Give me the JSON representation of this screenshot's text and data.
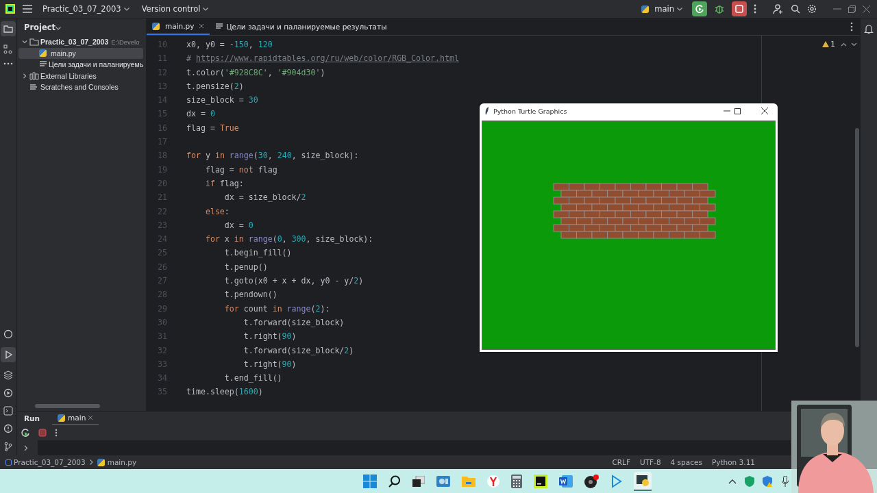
{
  "titlebar": {
    "project": "Practic_03_07_2003",
    "vcs": "Version control",
    "run_config": "main"
  },
  "project_panel": {
    "title": "Project",
    "tree": [
      {
        "label": "Practic_03_07_2003",
        "path": "E:\\Develo",
        "kind": "folder",
        "expanded": true,
        "selected": false,
        "children": [
          {
            "label": "main.py",
            "kind": "python",
            "selected": true
          },
          {
            "label": "Цели задачи и паланируемь",
            "kind": "text",
            "selected": false
          }
        ]
      },
      {
        "label": "External Libraries",
        "kind": "library",
        "expanded": false,
        "selected": false
      },
      {
        "label": "Scratches and Consoles",
        "kind": "scratch",
        "selected": false
      }
    ]
  },
  "tabs": [
    {
      "label": "main.py",
      "kind": "python",
      "selected": true,
      "closable": true
    },
    {
      "label": "Цели задачи и паланируемые результаты",
      "kind": "text",
      "selected": false,
      "closable": false
    }
  ],
  "editor": {
    "warnings": "1",
    "lines": [
      {
        "number": "10",
        "tokens": [
          {
            "kind": "plain",
            "text": "x0, y0 = -"
          },
          {
            "kind": "num",
            "text": "150"
          },
          {
            "kind": "plain",
            "text": ", "
          },
          {
            "kind": "num",
            "text": "120"
          }
        ]
      },
      {
        "number": "11",
        "tokens": [
          {
            "kind": "comment",
            "text": "# "
          },
          {
            "kind": "link",
            "text": "https://www.rapidtables.org/ru/web/color/RGB_Color.html"
          }
        ]
      },
      {
        "number": "12",
        "tokens": [
          {
            "kind": "plain",
            "text": "t.color("
          },
          {
            "kind": "str",
            "text": "'#928C8C'"
          },
          {
            "kind": "plain",
            "text": ", "
          },
          {
            "kind": "str",
            "text": "'#904d30'"
          },
          {
            "kind": "plain",
            "text": ")"
          }
        ]
      },
      {
        "number": "13",
        "tokens": [
          {
            "kind": "plain",
            "text": "t.pensize("
          },
          {
            "kind": "num",
            "text": "2"
          },
          {
            "kind": "plain",
            "text": ")"
          }
        ]
      },
      {
        "number": "14",
        "tokens": [
          {
            "kind": "plain",
            "text": "size_block = "
          },
          {
            "kind": "num",
            "text": "30"
          }
        ]
      },
      {
        "number": "15",
        "tokens": [
          {
            "kind": "plain",
            "text": "dx = "
          },
          {
            "kind": "num",
            "text": "0"
          }
        ]
      },
      {
        "number": "16",
        "tokens": [
          {
            "kind": "plain",
            "text": "flag = "
          },
          {
            "kind": "kw",
            "text": "True"
          }
        ]
      },
      {
        "number": "17"
      },
      {
        "number": "18",
        "tokens": [
          {
            "kind": "kw",
            "text": "for"
          },
          {
            "kind": "plain",
            "text": " y "
          },
          {
            "kind": "kw",
            "text": "in"
          },
          {
            "kind": "builtin",
            "text": " range"
          },
          {
            "kind": "plain",
            "text": "("
          },
          {
            "kind": "num",
            "text": "30"
          },
          {
            "kind": "plain",
            "text": ", "
          },
          {
            "kind": "num",
            "text": "240"
          },
          {
            "kind": "plain",
            "text": ", size_block):"
          }
        ]
      },
      {
        "number": "19",
        "tokens": [
          {
            "kind": "plain",
            "text": "    flag = "
          },
          {
            "kind": "kw",
            "text": "not"
          },
          {
            "kind": "plain",
            "text": " flag"
          }
        ]
      },
      {
        "number": "20",
        "tokens": [
          {
            "kind": "kw",
            "text": "    if"
          },
          {
            "kind": "plain",
            "text": " flag:"
          }
        ]
      },
      {
        "number": "21",
        "tokens": [
          {
            "kind": "plain",
            "text": "        dx = size_block/"
          },
          {
            "kind": "num",
            "text": "2"
          }
        ]
      },
      {
        "number": "22",
        "tokens": [
          {
            "kind": "kw",
            "text": "    else"
          },
          {
            "kind": "plain",
            "text": ":"
          }
        ]
      },
      {
        "number": "23",
        "tokens": [
          {
            "kind": "plain",
            "text": "        dx = "
          },
          {
            "kind": "num",
            "text": "0"
          }
        ]
      },
      {
        "number": "24",
        "tokens": [
          {
            "kind": "kw",
            "text": "    for"
          },
          {
            "kind": "plain",
            "text": " x "
          },
          {
            "kind": "kw",
            "text": "in"
          },
          {
            "kind": "builtin",
            "text": " range"
          },
          {
            "kind": "plain",
            "text": "("
          },
          {
            "kind": "num",
            "text": "0"
          },
          {
            "kind": "plain",
            "text": ", "
          },
          {
            "kind": "num",
            "text": "300"
          },
          {
            "kind": "plain",
            "text": ", size_block):"
          }
        ]
      },
      {
        "number": "25",
        "tokens": [
          {
            "kind": "plain",
            "text": "        t.begin_fill()"
          }
        ]
      },
      {
        "number": "26",
        "tokens": [
          {
            "kind": "plain",
            "text": "        t.penup()"
          }
        ]
      },
      {
        "number": "27",
        "tokens": [
          {
            "kind": "plain",
            "text": "        t.goto(x0 + x + dx, y0 - y/"
          },
          {
            "kind": "num",
            "text": "2"
          },
          {
            "kind": "plain",
            "text": ")"
          }
        ]
      },
      {
        "number": "28",
        "tokens": [
          {
            "kind": "plain",
            "text": "        t.pendown()"
          }
        ]
      },
      {
        "number": "29",
        "tokens": [
          {
            "kind": "kw",
            "text": "        for"
          },
          {
            "kind": "plain",
            "text": " count "
          },
          {
            "kind": "kw",
            "text": "in"
          },
          {
            "kind": "builtin",
            "text": " range"
          },
          {
            "kind": "plain",
            "text": "("
          },
          {
            "kind": "num",
            "text": "2"
          },
          {
            "kind": "plain",
            "text": "):"
          }
        ]
      },
      {
        "number": "30",
        "tokens": [
          {
            "kind": "plain",
            "text": "            t.forward(size_block)"
          }
        ]
      },
      {
        "number": "31",
        "tokens": [
          {
            "kind": "plain",
            "text": "            t.right("
          },
          {
            "kind": "num",
            "text": "90"
          },
          {
            "kind": "plain",
            "text": ")"
          }
        ]
      },
      {
        "number": "32",
        "tokens": [
          {
            "kind": "plain",
            "text": "            t.forward(size_block/"
          },
          {
            "kind": "num",
            "text": "2"
          },
          {
            "kind": "plain",
            "text": ")"
          }
        ]
      },
      {
        "number": "33",
        "tokens": [
          {
            "kind": "plain",
            "text": "            t.right("
          },
          {
            "kind": "num",
            "text": "90"
          },
          {
            "kind": "plain",
            "text": ")"
          }
        ]
      },
      {
        "number": "34",
        "tokens": [
          {
            "kind": "plain",
            "text": "        t.end_fill()"
          }
        ]
      },
      {
        "number": "35",
        "tokens": [
          {
            "kind": "plain",
            "text": "time.sleep("
          },
          {
            "kind": "num",
            "text": "1600"
          },
          {
            "kind": "plain",
            "text": ")"
          }
        ]
      }
    ]
  },
  "turtle_window": {
    "title": "Python Turtle Graphics"
  },
  "run_panel": {
    "title": "Run",
    "tab": {
      "label": "main",
      "selected": true
    }
  },
  "status_bar": {
    "breadcrumbs": [
      "Practic_03_07_2003",
      "main.py"
    ],
    "items": [
      "CRLF",
      "UTF-8",
      "4 spaces",
      "Python 3.11"
    ]
  }
}
